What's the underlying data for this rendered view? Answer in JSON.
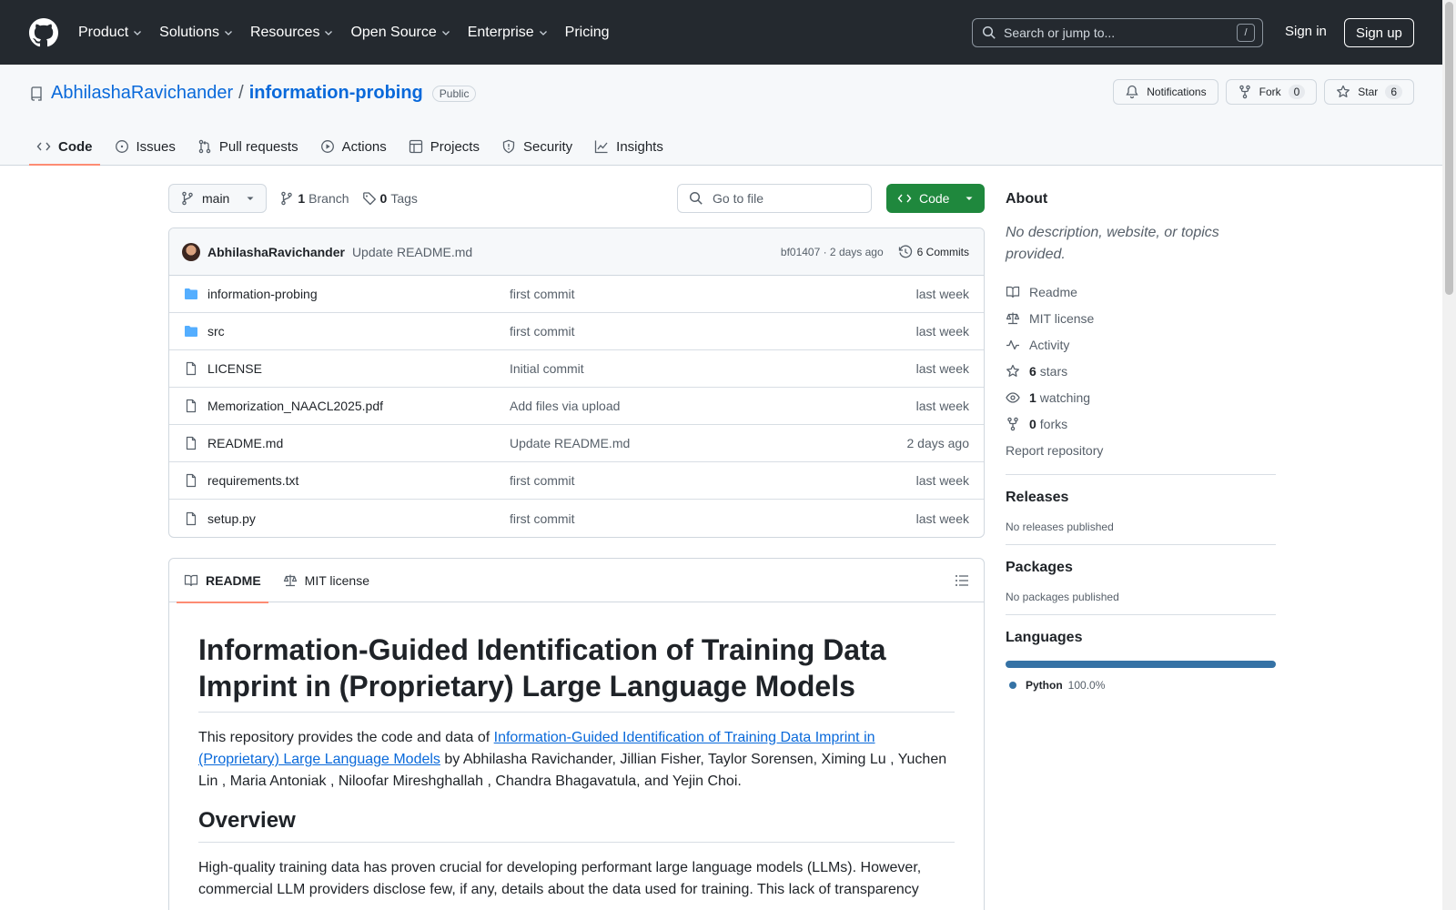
{
  "header": {
    "nav": [
      {
        "label": "Product",
        "dropdown": true
      },
      {
        "label": "Solutions",
        "dropdown": true
      },
      {
        "label": "Resources",
        "dropdown": true
      },
      {
        "label": "Open Source",
        "dropdown": true
      },
      {
        "label": "Enterprise",
        "dropdown": true
      },
      {
        "label": "Pricing",
        "dropdown": false
      }
    ],
    "search_placeholder": "Search or jump to...",
    "search_key": "/",
    "sign_in": "Sign in",
    "sign_up": "Sign up"
  },
  "repo": {
    "owner": "AbhilashaRavichander",
    "separator": "/",
    "name": "information-probing",
    "visibility": "Public",
    "notifications_label": "Notifications",
    "fork_label": "Fork",
    "fork_count": "0",
    "star_label": "Star",
    "star_count": "6",
    "tabs": [
      {
        "label": "Code",
        "icon": "code-icon",
        "active": true
      },
      {
        "label": "Issues",
        "icon": "issue-icon",
        "active": false
      },
      {
        "label": "Pull requests",
        "icon": "pull-request-icon",
        "active": false
      },
      {
        "label": "Actions",
        "icon": "play-icon",
        "active": false
      },
      {
        "label": "Projects",
        "icon": "table-icon",
        "active": false
      },
      {
        "label": "Security",
        "icon": "shield-icon",
        "active": false
      },
      {
        "label": "Insights",
        "icon": "graph-icon",
        "active": false
      }
    ]
  },
  "toolbar": {
    "branch": "main",
    "branch_count": "1",
    "branch_label": "Branch",
    "tag_count": "0",
    "tag_label": "Tags",
    "goto_placeholder": "Go to file",
    "code_button": "Code"
  },
  "latest_commit": {
    "author": "AbhilashaRavichander",
    "message": "Update README.md",
    "meta": "bf01407 · 2 days ago",
    "commits_label": "6 Commits"
  },
  "files": [
    {
      "name": "information-probing",
      "type": "folder",
      "message": "first commit",
      "date": "last week"
    },
    {
      "name": "src",
      "type": "folder",
      "message": "first commit",
      "date": "last week"
    },
    {
      "name": "LICENSE",
      "type": "file",
      "message": "Initial commit",
      "date": "last week"
    },
    {
      "name": "Memorization_NAACL2025.pdf",
      "type": "file",
      "message": "Add files via upload",
      "date": "last week"
    },
    {
      "name": "README.md",
      "type": "file",
      "message": "Update README.md",
      "date": "2 days ago"
    },
    {
      "name": "requirements.txt",
      "type": "file",
      "message": "first commit",
      "date": "last week"
    },
    {
      "name": "setup.py",
      "type": "file",
      "message": "first commit",
      "date": "last week"
    }
  ],
  "readme": {
    "tab_readme": "README",
    "tab_license": "MIT license",
    "title": "Information-Guided Identification of Training Data Imprint in (Proprietary) Large Language Models",
    "intro_before": "This repository provides the code and data of ",
    "intro_link": "Information-Guided Identification of Training Data Imprint in (Proprietary) Large Language Models",
    "intro_after": " by Abhilasha Ravichander, Jillian Fisher, Taylor Sorensen, Ximing Lu , Yuchen Lin , Maria Antoniak , Niloofar Mireshghallah , Chandra Bhagavatula, and Yejin Choi.",
    "overview_heading": "Overview",
    "overview_text": "High-quality training data has proven crucial for developing performant large language models (LLMs). However, commercial LLM providers disclose few, if any, details about the data used for training. This lack of transparency"
  },
  "sidebar": {
    "about_title": "About",
    "about_desc": "No description, website, or topics provided.",
    "links": [
      {
        "icon": "book-icon",
        "count": "",
        "label": "Readme"
      },
      {
        "icon": "law-icon",
        "count": "",
        "label": "MIT license"
      },
      {
        "icon": "pulse-icon",
        "count": "",
        "label": "Activity"
      },
      {
        "icon": "star-icon",
        "count": "6",
        "label": "stars"
      },
      {
        "icon": "eye-icon",
        "count": "1",
        "label": "watching"
      },
      {
        "icon": "fork-icon",
        "count": "0",
        "label": "forks"
      }
    ],
    "report": "Report repository",
    "releases_title": "Releases",
    "releases_text": "No releases published",
    "packages_title": "Packages",
    "packages_text": "No packages published",
    "languages_title": "Languages",
    "languages": [
      {
        "name": "Python",
        "percent": "100.0%",
        "color": "#3572a5"
      }
    ]
  }
}
